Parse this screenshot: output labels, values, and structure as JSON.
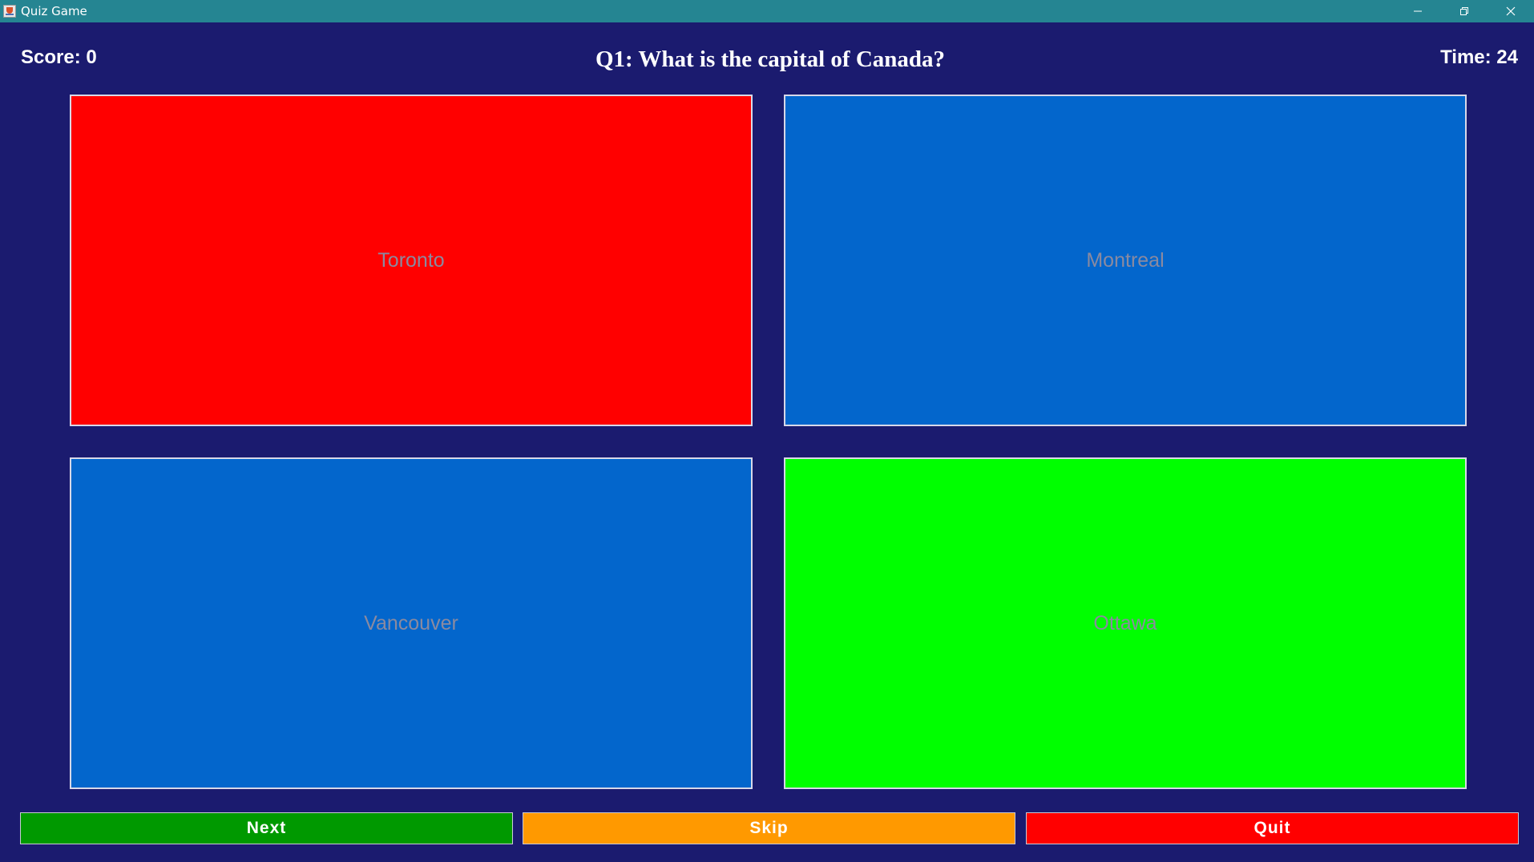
{
  "window": {
    "title": "Quiz Game",
    "title_bar_color": "#258592"
  },
  "header": {
    "score": "Score: 0",
    "question": "Q1: What is the capital of Canada?",
    "time": "Time: 24"
  },
  "answers": [
    {
      "label": "Toronto",
      "color": "#ff0000",
      "state": "incorrect"
    },
    {
      "label": "Montreal",
      "color": "#0366cc",
      "state": "neutral"
    },
    {
      "label": "Vancouver",
      "color": "#0366cc",
      "state": "neutral"
    },
    {
      "label": "Ottawa",
      "color": "#00ff00",
      "state": "correct"
    }
  ],
  "buttons": {
    "next": {
      "label": "Next",
      "color": "#009900"
    },
    "skip": {
      "label": "Skip",
      "color": "#ff9900"
    },
    "quit": {
      "label": "Quit",
      "color": "#ff0000"
    }
  },
  "colors": {
    "background": "#1b1b6f",
    "answer_text": "#8a8aa0"
  },
  "icons": {
    "app": "java-cup-icon",
    "minimize": "minimize-icon",
    "restore": "restore-icon",
    "close": "close-icon"
  }
}
